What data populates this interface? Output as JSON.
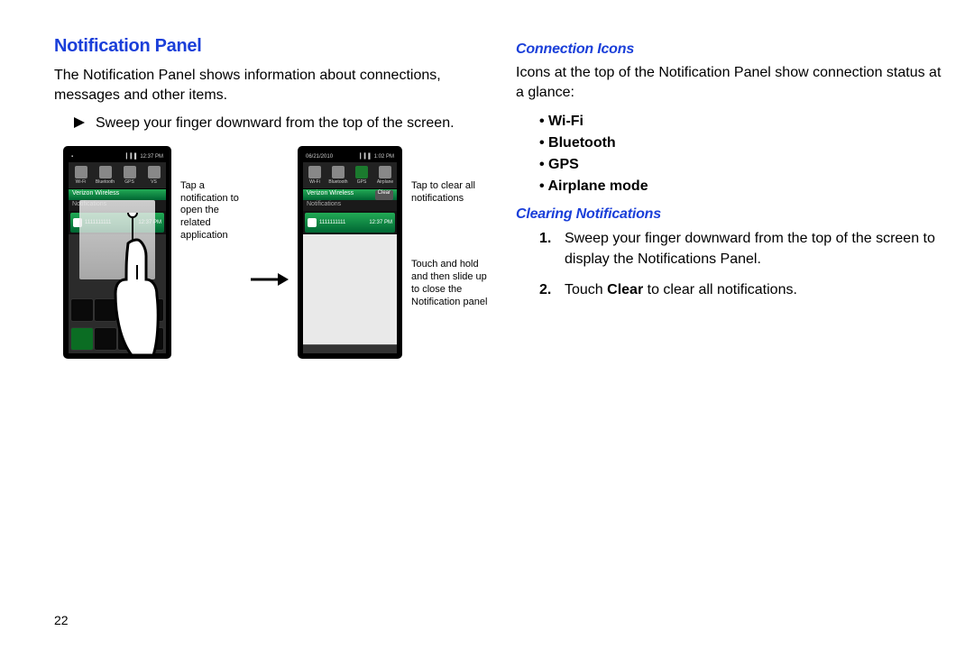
{
  "page_number": "22",
  "left": {
    "heading": "Notification Panel",
    "intro": "The Notification Panel shows information about connections, messages and other items.",
    "instruction": "Sweep your finger downward from the top of the screen.",
    "caption_left": "Tap a notification to open the related application",
    "caption_right_top": "Tap to clear all notifications",
    "caption_right_bottom": "Touch and hold and then slide up to close the Notification panel"
  },
  "right": {
    "sub1": "Connection Icons",
    "sub1_body": "Icons at the top of the Notification Panel show connection status at a glance:",
    "bullets": [
      "Wi-Fi",
      "Bluetooth",
      "GPS",
      "Airplane mode"
    ],
    "sub2": "Clearing Notifications",
    "steps": [
      "Sweep your finger downward from the top of the screen to display the Notifications Panel.",
      "Touch Clear to clear all notifications."
    ],
    "clear_word": "Clear"
  },
  "phone": {
    "date": "06/21/2010",
    "time_a": "12:37 PM",
    "time_b": "1:02 PM",
    "quick": [
      "Wi-Fi",
      "Bluetooth",
      "GPS",
      "VS"
    ],
    "quick_b": [
      "Wi-Fi",
      "Bluetooth",
      "GPS",
      "Airplane"
    ],
    "carrier": "Verizon Wireless",
    "clear": "Clear",
    "notif_label": "Notifications",
    "notif_text": "1111111111",
    "notif_time": "12:37 PM"
  }
}
